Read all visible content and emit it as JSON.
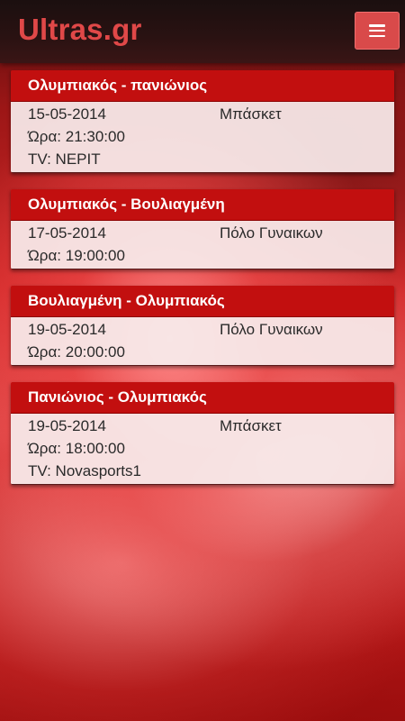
{
  "app": {
    "title": "Ultras.gr",
    "menu_icon": "hamburger-menu-icon"
  },
  "colors": {
    "header_bg": "#2a1212",
    "title_color": "#e04848",
    "menu_button_bg": "#d94a4a",
    "card_header_bg": "#c20f0f",
    "card_body_bg": "#f8ecec"
  },
  "events": [
    {
      "title": "Ολυμπιακός - πανιώνιος",
      "date": "15-05-2014",
      "sport": "Μπάσκετ",
      "time": "Ώρα: 21:30:00",
      "tv": "TV: NEPIT"
    },
    {
      "title": "Ολυμπιακός - Βουλιαγμένη",
      "date": "17-05-2014",
      "sport": "Πόλο Γυναικων",
      "time": "Ώρα: 19:00:00",
      "tv": null
    },
    {
      "title": "Βουλιαγμένη - Ολυμπιακός",
      "date": "19-05-2014",
      "sport": "Πόλο Γυναικων",
      "time": "Ώρα: 20:00:00",
      "tv": null
    },
    {
      "title": "Πανιώνιος - Ολυμπιακός",
      "date": "19-05-2014",
      "sport": "Μπάσκετ",
      "time": "Ώρα: 18:00:00",
      "tv": "TV: Novasports1"
    }
  ]
}
